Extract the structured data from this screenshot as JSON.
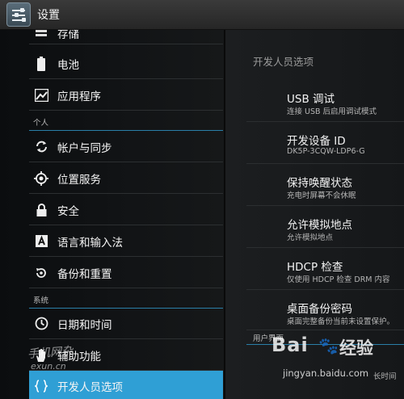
{
  "actionbar": {
    "title": "设置",
    "icon": "settings-sliders-icon"
  },
  "left": {
    "items": [
      {
        "id": "storage",
        "label": "存储",
        "icon": "storage-icon"
      },
      {
        "id": "battery",
        "label": "电池",
        "icon": "battery-icon"
      },
      {
        "id": "apps",
        "label": "应用程序",
        "icon": "apps-icon"
      },
      {
        "id": "accounts",
        "label": "帐户与同步",
        "icon": "sync-icon"
      },
      {
        "id": "location",
        "label": "位置服务",
        "icon": "location-icon"
      },
      {
        "id": "security",
        "label": "安全",
        "icon": "lock-icon"
      },
      {
        "id": "language",
        "label": "语言和输入法",
        "icon": "keyboard-icon"
      },
      {
        "id": "backup",
        "label": "备份和重置",
        "icon": "backup-icon"
      },
      {
        "id": "datetime",
        "label": "日期和时间",
        "icon": "clock-icon"
      },
      {
        "id": "accessibility",
        "label": "辅助功能",
        "icon": "hand-icon"
      },
      {
        "id": "developer",
        "label": "开发人员选项",
        "icon": "braces-icon",
        "selected": true
      }
    ],
    "sections": {
      "personal": "个人",
      "system": "系统"
    }
  },
  "right": {
    "title": "开发人员选项",
    "prefs": [
      {
        "title": "USB 调试",
        "summary": "连接 USB 后启用调试模式"
      },
      {
        "title": "开发设备 ID",
        "summary": "DK5P-3CQW-LDP6-G"
      },
      {
        "title": "保持唤醒状态",
        "summary": "充电时屏幕不会休眠"
      },
      {
        "title": "允许模拟地点",
        "summary": "允许模拟地点"
      },
      {
        "title": "HDCP 检查",
        "summary": "仅使用 HDCP 检查 DRM 内容"
      },
      {
        "title": "桌面备份密码",
        "summary": "桌面完整备份当前未设置保护。"
      }
    ],
    "ui_section": "用户界面",
    "partial_summary": "长时间"
  },
  "watermarks": {
    "left_line1": "手机网杂",
    "left_line2": "exun.cn",
    "baidu": "Bai",
    "paw": "🐾",
    "jingyan": "经验",
    "url": "jingyan.baidu.com"
  },
  "colors": {
    "selected": "#2f9fd5",
    "section_line": "#2a7fa8"
  }
}
